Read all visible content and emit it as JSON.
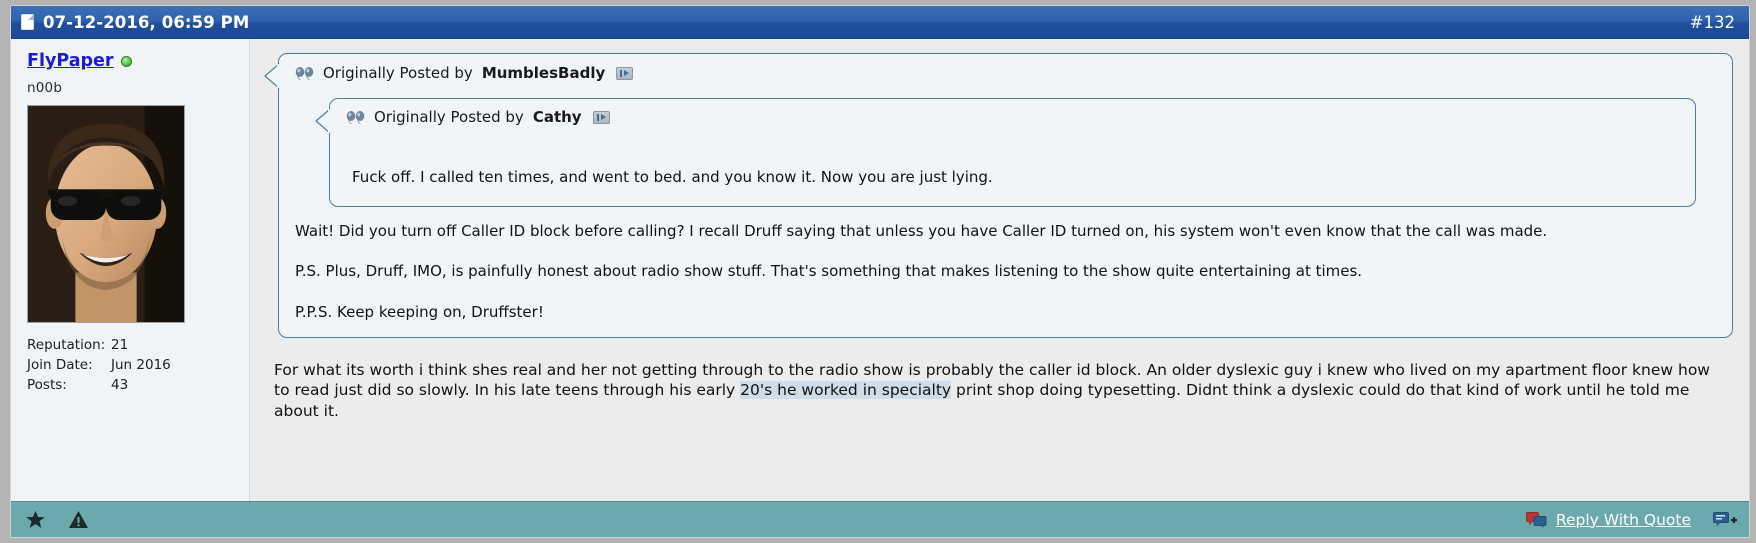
{
  "header": {
    "date": "07-12-2016, 06:59 PM",
    "post_number": "#132",
    "doc_icon": "document-icon",
    "bg_color": "#2a5fa8",
    "text_color": "#ffffff"
  },
  "user": {
    "name": "FlyPaper",
    "name_color": "#1b1bd4",
    "online_status": "online",
    "title": "n00b",
    "avatar_alt": "user-avatar",
    "stats": [
      {
        "label": "Reputation:",
        "value": "21"
      },
      {
        "label": "Join Date:",
        "value": "Jun 2016"
      },
      {
        "label": "Posts:",
        "value": "43"
      }
    ]
  },
  "quotes": {
    "outer": {
      "prefix": "Originally Posted by",
      "author": "MumblesBadly",
      "quote_icon": "double-quote-icon",
      "link_icon": "view-post-icon",
      "paragraphs": [
        "Wait! Did you turn off Caller ID block before calling? I recall Druff saying that unless you have Caller ID turned on, his system won't even know that the call was made.",
        "P.S. Plus, Druff, IMO, is painfully honest about radio show stuff. That's something that makes listening to the show quite entertaining at times.",
        "P.P.S. Keep keeping on, Druffster!"
      ]
    },
    "inner": {
      "prefix": "Originally Posted by",
      "author": "Cathy",
      "quote_icon": "double-quote-icon",
      "link_icon": "view-post-icon",
      "text": "Fuck off. I called ten times, and went to bed. and you know it. Now you are just lying."
    },
    "border_color": "#4d7d9e",
    "bg_color": "#f2f5f7"
  },
  "post_text": {
    "part1": "For what its worth i think shes real and her not getting through to the radio show is probably the caller id block. An older dyslexic guy i knew who lived on my apartment floor knew how to read just did so slowly. In his late teens through his early ",
    "selected": "20's he worked in specialty",
    "part2": " print shop doing typesetting. Didnt think a dyslexic could do that kind of work until he told me about it.",
    "selection_color": "#cfdcea"
  },
  "footer": {
    "bg_color": "#6ba9ad",
    "star_icon": "star-icon",
    "warn_icon": "report-warning-icon",
    "reply_label": "Reply With Quote",
    "reply_icon": "quote-bubbles-icon",
    "multiquote_icon": "multi-quote-add-icon"
  }
}
